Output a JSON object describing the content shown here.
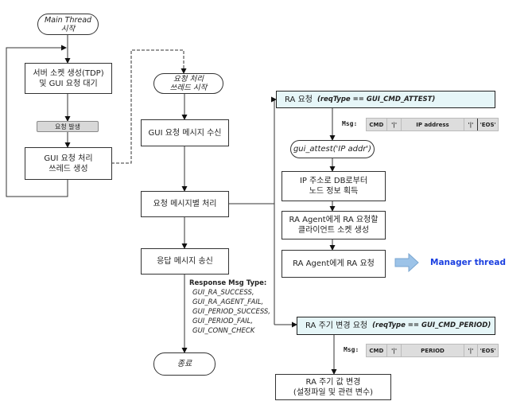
{
  "main_thread_start": "Main Thread\n시작",
  "server_socket": "서버 소켓 생성(TDP)\n및 GUI 요청 대기",
  "request_occurs": "요청 발생",
  "create_thread": "GUI 요청 처리\n쓰레드 생성",
  "req_thread_start": "요청 처리\n쓰레드 시작",
  "recv_msg": "GUI 요청 메시지 수신",
  "process_msg": "요청 메시지별 처리",
  "send_resp": "응답 메시지 송신",
  "end": "종료",
  "response": {
    "title": "Response Msg Type:",
    "items": [
      "GUI_RA_SUCCESS,",
      "GUI_RA_AGENT_FAIL,",
      "GUI_PERIOD_SUCCESS,",
      "GUI_PERIOD_FAIL,",
      "GUI_CONN_CHECK"
    ]
  },
  "ra_request": {
    "label": "RA 요청",
    "cond": "(reqType == GUI_CMD_ATTEST)"
  },
  "msg_label": "Msg:",
  "attest_msg": [
    "CMD",
    "'|'",
    "IP address",
    "'|'",
    "'EOS'"
  ],
  "gui_attest": "gui_attest('IP addr')",
  "get_node": "IP 주소로 DB로부터\n노드 정보 획득",
  "client_socket": "RA Agent에게 RA 요청할\n클라이언트 소켓 생성",
  "ra_send": "RA Agent에게 RA 요청",
  "manager_thread": "Manager thread",
  "period_request": {
    "label": "RA 주기 변경 요청",
    "cond": "(reqType == GUI_CMD_PERIOD)"
  },
  "period_msg": [
    "CMD",
    "'|'",
    "PERIOD",
    "'|'",
    "'EOS'"
  ],
  "period_change": "RA 주기 값 변경\n(설정파일 및 관련 변수)",
  "colors": {
    "accent_text": "#1a3fe0",
    "arrow_fill": "#9cc3e8",
    "box_fill": "#e6f6f8"
  }
}
